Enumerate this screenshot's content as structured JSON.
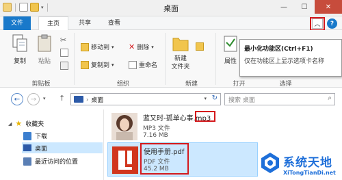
{
  "window": {
    "title": "桌面"
  },
  "tabs": {
    "file": "文件",
    "home": "主页",
    "share": "共享",
    "view": "查看"
  },
  "ribbon": {
    "clipboard": {
      "copy": "复制",
      "paste": "粘贴",
      "label": "剪贴板"
    },
    "organize": {
      "move_to": "移动到",
      "copy_to": "复制到",
      "delete": "删除",
      "rename": "重命名",
      "label": "组织"
    },
    "new": {
      "new_folder": "新建\n文件夹",
      "label": "新建"
    },
    "open": {
      "properties": "属性",
      "label": "打开"
    },
    "select": {
      "label": "选择"
    }
  },
  "tooltip": {
    "title": "最小化功能区(Ctrl+F1)",
    "body": "仅在功能区上显示选项卡名称"
  },
  "address": {
    "path": "桌面",
    "search_placeholder": "搜索 桌面"
  },
  "nav": {
    "favorites": "收藏夹",
    "downloads": "下载",
    "desktop": "桌面",
    "recent": "最近访问的位置"
  },
  "files": [
    {
      "name": "蓝又时-孤单心事.mp3",
      "type": "MP3 文件",
      "size": "7.16 MB"
    },
    {
      "name": "使用手册.pdf",
      "type": "PDF 文件",
      "size": "45.2 MB"
    }
  ],
  "watermark": {
    "title": "系统天地",
    "url": "XiTongTianDi.net"
  },
  "colors": {
    "accent": "#1979ca",
    "highlight": "#d4181c",
    "selection": "#cce8ff"
  }
}
